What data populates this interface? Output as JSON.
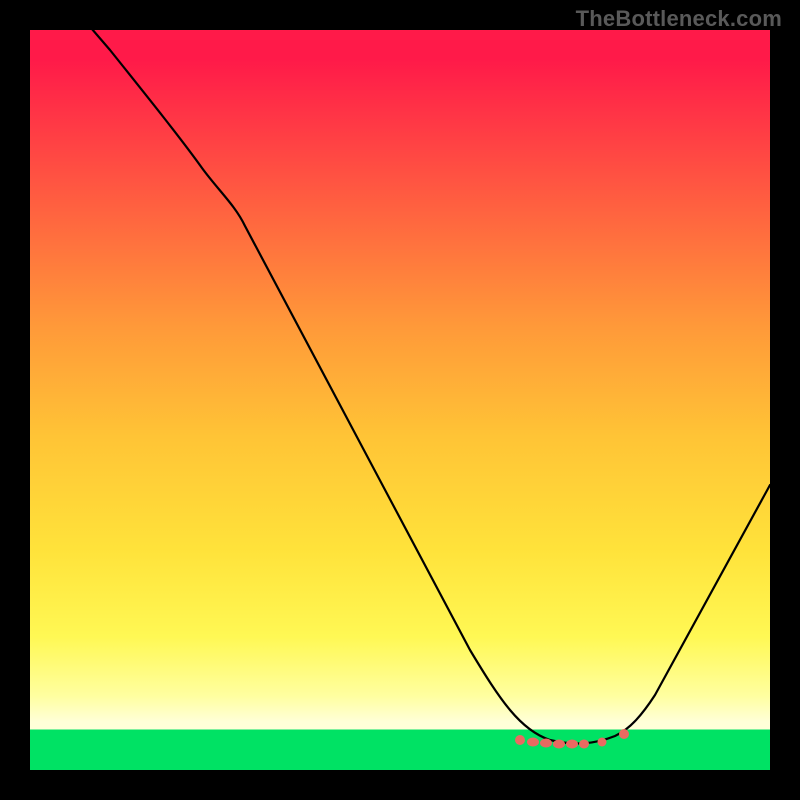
{
  "watermark": "TheBottleneck.com",
  "chart_data": {
    "type": "line",
    "title": "",
    "xlabel": "",
    "ylabel": "",
    "x": [
      0.0,
      0.05,
      0.1,
      0.15,
      0.2,
      0.25,
      0.3,
      0.35,
      0.4,
      0.45,
      0.5,
      0.55,
      0.6,
      0.65,
      0.68,
      0.72,
      0.75,
      0.78,
      0.8,
      0.85,
      0.9,
      0.95,
      1.0
    ],
    "values": [
      1.07,
      1.0,
      0.93,
      0.87,
      0.79,
      0.7,
      0.61,
      0.52,
      0.44,
      0.35,
      0.27,
      0.19,
      0.11,
      0.05,
      0.02,
      0.01,
      0.01,
      0.02,
      0.04,
      0.11,
      0.2,
      0.3,
      0.4
    ],
    "xlim": [
      0,
      1
    ],
    "ylim": [
      0,
      1
    ],
    "grid": false,
    "background_gradient": "red-yellow-green vertical",
    "marker_region_x": [
      0.66,
      0.8
    ],
    "annotations": []
  },
  "colors": {
    "line": "#000000",
    "markers": "#e86a61",
    "background": "#000000",
    "green_band": "#00e264"
  }
}
